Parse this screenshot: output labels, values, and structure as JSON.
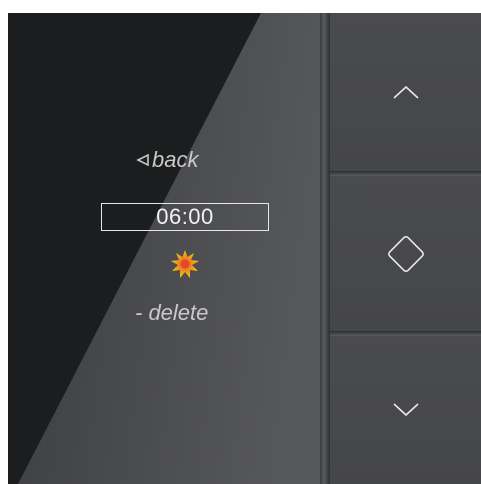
{
  "display": {
    "back_label": "back",
    "time_value": "06:00",
    "delete_label": "- delete",
    "mode_icon": "sun-icon"
  },
  "buttons": {
    "up": "chevron-up-icon",
    "ok": "diamond-icon",
    "down": "chevron-down-icon"
  },
  "colors": {
    "sun_outer": "#f5c518",
    "sun_inner": "#e04a2a",
    "text": "#c9c9c9",
    "time_text": "#f2f2f2"
  }
}
